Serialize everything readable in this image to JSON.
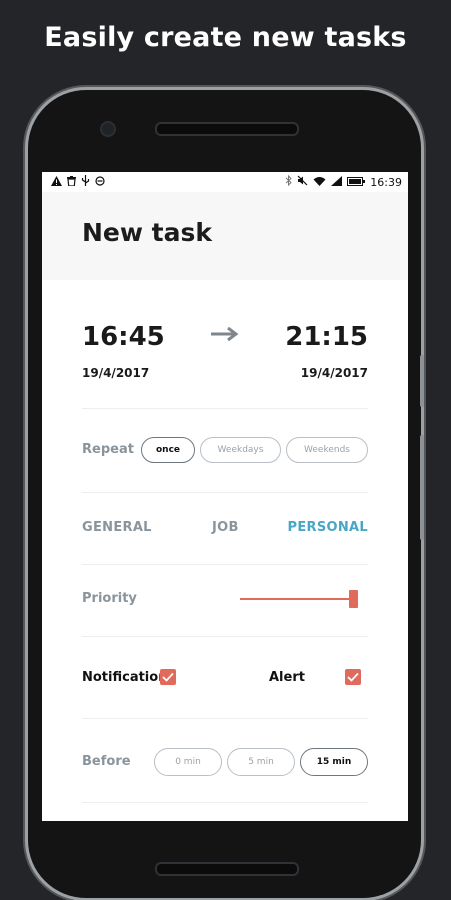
{
  "headline": "Easily create new tasks",
  "status_bar": {
    "left_icons": [
      "warning-icon",
      "trash-icon",
      "usb-icon",
      "sync-icon"
    ],
    "right_icons": [
      "bluetooth-icon",
      "mute-icon",
      "wifi-icon",
      "signal-icon",
      "battery-icon"
    ],
    "time": "16:39"
  },
  "header": {
    "title": "New task"
  },
  "schedule": {
    "start_time": "16:45",
    "start_date": "19/4/2017",
    "end_time": "21:15",
    "end_date": "19/4/2017"
  },
  "repeat": {
    "label": "Repeat",
    "options": [
      "once",
      "Weekdays",
      "Weekends"
    ],
    "selected": "once"
  },
  "categories": {
    "items": [
      "GENERAL",
      "JOB",
      "PERSONAL"
    ],
    "active": "PERSONAL",
    "active_color": "#49a6c4"
  },
  "priority": {
    "label": "Priority",
    "level": 1.0
  },
  "notification": {
    "label": "Notification",
    "checked": true
  },
  "alert": {
    "label": "Alert",
    "checked": true
  },
  "before": {
    "label": "Before",
    "options": [
      "0 min",
      "5 min",
      "15 min"
    ],
    "selected": "15 min"
  },
  "colors": {
    "accent": "#e06a5b",
    "muted": "#8a949c",
    "background": "#232528"
  }
}
